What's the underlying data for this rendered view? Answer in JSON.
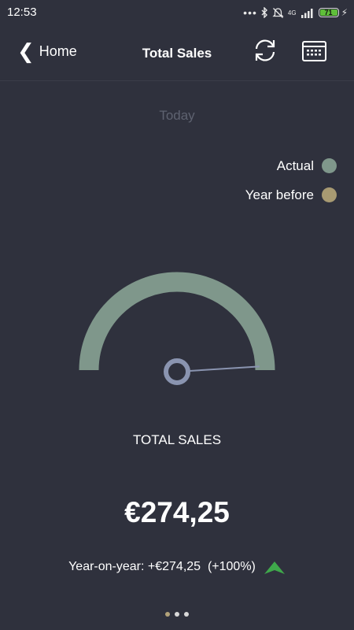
{
  "status_bar": {
    "time": "12:53",
    "network": "4G",
    "battery": "71"
  },
  "navbar": {
    "back_label": "Home",
    "title": "Total Sales"
  },
  "period": "Today",
  "legend": [
    {
      "label": "Actual",
      "color": "#7f978b"
    },
    {
      "label": "Year before",
      "color": "#a89a72"
    }
  ],
  "gauge": {
    "actual_fraction": 1.0,
    "needle_fraction": 0.98,
    "arc_color": "#7f978b",
    "pivot_color": "#8a94b0"
  },
  "metric": {
    "label": "TOTAL SALES",
    "value": "€274,25",
    "yoy_text": "Year-on-year: +€274,25  (+100%)",
    "trend_color": "#3fa84b"
  },
  "pager": {
    "count": 3,
    "active_index": 0
  }
}
